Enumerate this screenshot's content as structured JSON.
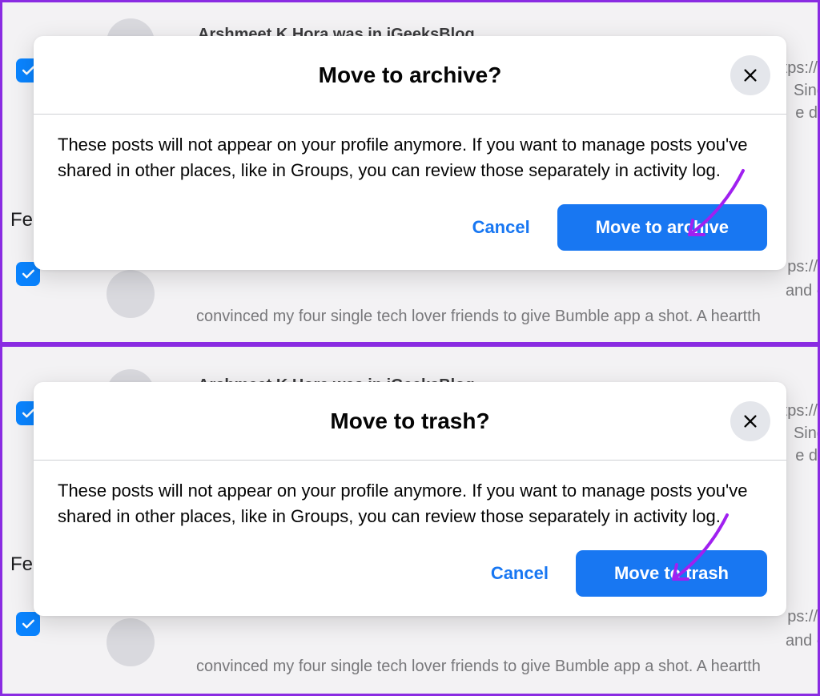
{
  "background": {
    "post_header": "Arshmeet K Hora was in iGeeksBlog",
    "snippet_right_1": "tps://v",
    "snippet_right_2": "Sing",
    "snippet_right_3": "e dy",
    "feed_label": "Fe",
    "snippet_bottom_right": "ps://v",
    "snippet_bottom_1": "and e",
    "snippet_bottom_2": "convinced my four single tech lover friends to give Bumble app a shot. A heartth"
  },
  "dialogs": [
    {
      "title": "Move to archive?",
      "body": "These posts will not appear on your profile anymore. If you want to manage posts you've shared in other places, like in Groups, you can review those separately in activity log.",
      "cancel_label": "Cancel",
      "confirm_label": "Move to archive"
    },
    {
      "title": "Move to trash?",
      "body": "These posts will not appear on your profile anymore. If you want to manage posts you've shared in other places, like in Groups, you can review those separately in activity log.",
      "cancel_label": "Cancel",
      "confirm_label": "Move to trash"
    }
  ],
  "colors": {
    "primary": "#1877f2",
    "annotation": "#a020f0"
  }
}
